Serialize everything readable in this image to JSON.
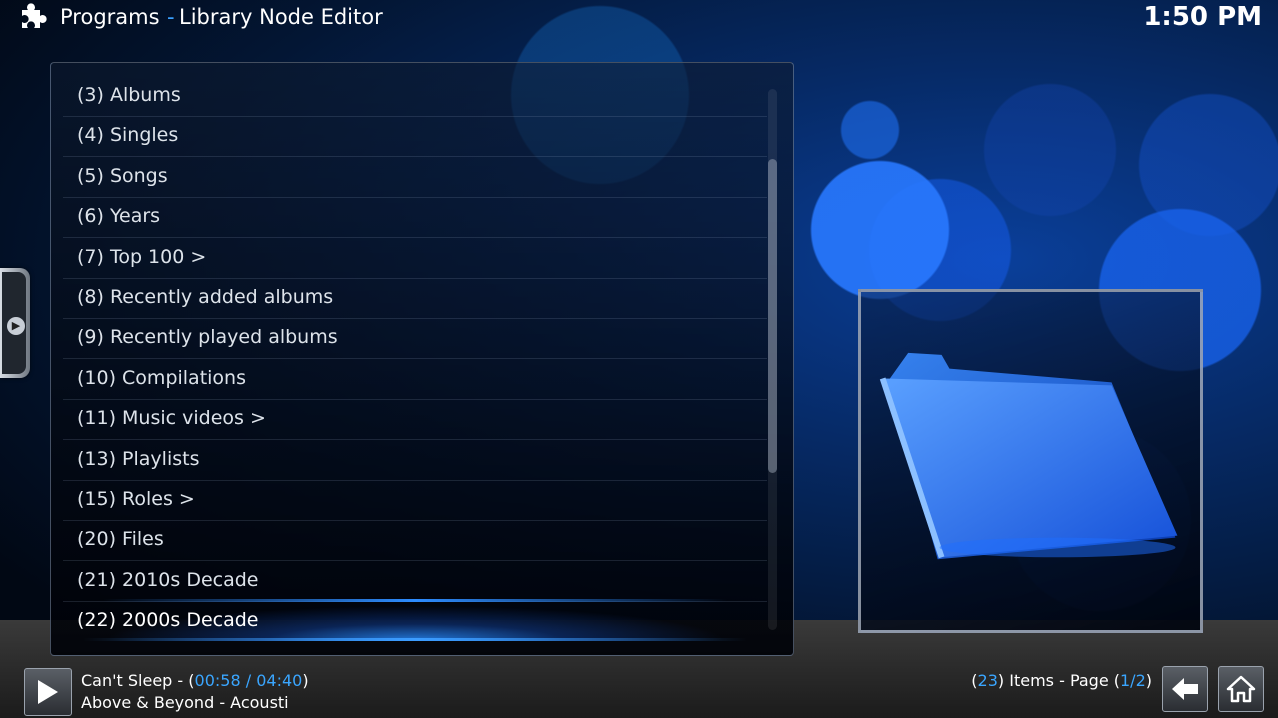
{
  "header": {
    "section": "Programs",
    "separator": "-",
    "page_title": "Library Node Editor",
    "clock": "1:50 PM"
  },
  "list": {
    "items": [
      {
        "label": "(3) Albums"
      },
      {
        "label": "(4) Singles"
      },
      {
        "label": "(5) Songs"
      },
      {
        "label": "(6) Years"
      },
      {
        "label": "(7) Top 100 >"
      },
      {
        "label": "(8) Recently added albums"
      },
      {
        "label": "(9) Recently played albums"
      },
      {
        "label": "(10) Compilations"
      },
      {
        "label": "(11) Music videos >"
      },
      {
        "label": "(13) Playlists"
      },
      {
        "label": "(15) Roles >"
      },
      {
        "label": "(20) Files"
      },
      {
        "label": "(21) 2010s Decade"
      },
      {
        "label": "(22) 2000s Decade",
        "selected": true
      }
    ],
    "scroll_position": 0.13,
    "scroll_visible_fraction": 0.58
  },
  "thumbnail": {
    "icon": "folder-icon"
  },
  "now_playing": {
    "play_icon": "play-icon",
    "track": "Can't Sleep",
    "dash": " - ",
    "open_paren": "(",
    "elapsed": "00:58",
    "slash": " / ",
    "duration": "04:40",
    "close_paren": ")",
    "artist_album": "Above & Beyond - Acousti"
  },
  "page_info": {
    "open_paren": "(",
    "item_count": "23",
    "items_text": ") Items - Page (",
    "page": "1/2",
    "close_paren": ")"
  },
  "nav": {
    "back_icon": "back-arrow-icon",
    "home_icon": "home-icon"
  },
  "colors": {
    "accent": "#3aa6ff",
    "background": "#031634",
    "highlight": "#2d8cff"
  }
}
